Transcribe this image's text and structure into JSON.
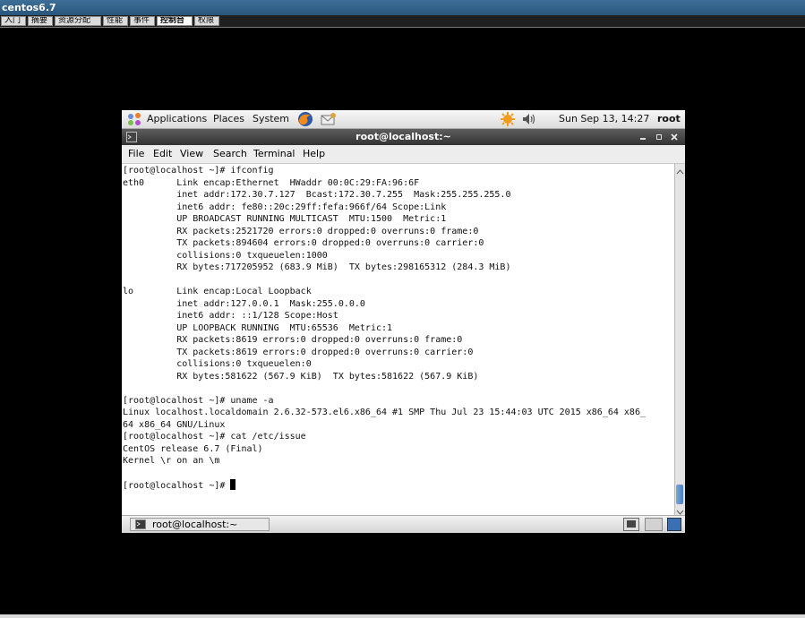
{
  "app": {
    "title": "centos6.7",
    "tabs": [
      "入门",
      "摘要",
      "资源分配",
      "性能",
      "事件",
      "控制台",
      "权限"
    ],
    "active_tab": 5
  },
  "guest_panel": {
    "applications": "Applications",
    "places": "Places",
    "system": "System",
    "datetime": "Sun Sep 13, 14:27",
    "user": "root"
  },
  "terminal_window": {
    "title": "root@localhost:~",
    "menu": [
      "File",
      "Edit",
      "View",
      "Search",
      "Terminal",
      "Help"
    ],
    "lines": [
      "[root@localhost ~]# ifconfig",
      "eth0      Link encap:Ethernet  HWaddr 00:0C:29:FA:96:6F",
      "          inet addr:172.30.7.127  Bcast:172.30.7.255  Mask:255.255.255.0",
      "          inet6 addr: fe80::20c:29ff:fefa:966f/64 Scope:Link",
      "          UP BROADCAST RUNNING MULTICAST  MTU:1500  Metric:1",
      "          RX packets:2521720 errors:0 dropped:0 overruns:0 frame:0",
      "          TX packets:894604 errors:0 dropped:0 overruns:0 carrier:0",
      "          collisions:0 txqueuelen:1000",
      "          RX bytes:717205952 (683.9 MiB)  TX bytes:298165312 (284.3 MiB)",
      "",
      "lo        Link encap:Local Loopback",
      "          inet addr:127.0.0.1  Mask:255.0.0.0",
      "          inet6 addr: ::1/128 Scope:Host",
      "          UP LOOPBACK RUNNING  MTU:65536  Metric:1",
      "          RX packets:8619 errors:0 dropped:0 overruns:0 frame:0",
      "          TX packets:8619 errors:0 dropped:0 overruns:0 carrier:0",
      "          collisions:0 txqueuelen:0",
      "          RX bytes:581622 (567.9 KiB)  TX bytes:581622 (567.9 KiB)",
      "",
      "[root@localhost ~]# uname -a",
      "Linux localhost.localdomain 2.6.32-573.el6.x86_64 #1 SMP Thu Jul 23 15:44:03 UTC 2015 x86_64 x86_",
      "64 x86_64 GNU/Linux",
      "[root@localhost ~]# cat /etc/issue",
      "CentOS release 6.7 (Final)",
      "Kernel \\r on an \\m",
      ""
    ],
    "prompt": "[root@localhost ~]# "
  },
  "taskbar": {
    "item": "root@localhost:~"
  }
}
